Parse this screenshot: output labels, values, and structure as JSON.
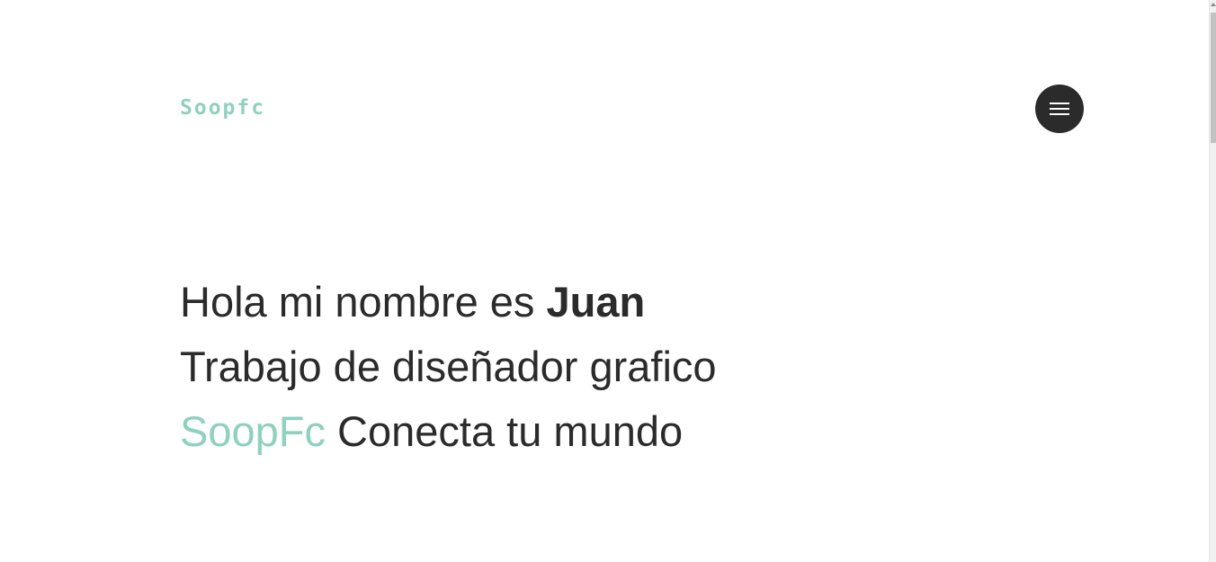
{
  "header": {
    "logo_text": "Soopfc",
    "menu_icon": "hamburger-menu-icon"
  },
  "hero": {
    "greeting": "Hola mi nombre es ",
    "name": "Juan",
    "role": "Trabajo de diseñador grafico",
    "brand": "SoopFc",
    "tagline": " Conecta tu mundo"
  },
  "colors": {
    "accent": "#8fd0bf",
    "text": "#2b2b2b",
    "menu_button_bg": "#2b2b2b",
    "background": "#ffffff"
  }
}
